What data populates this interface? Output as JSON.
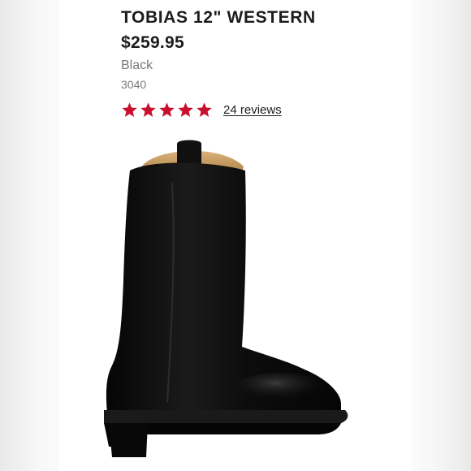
{
  "product": {
    "title": "TOBIAS 12\" WESTERN",
    "price": "$259.95",
    "color": "Black",
    "sku": "3040",
    "image_icon": "western-boot-icon"
  },
  "rating": {
    "stars": 5,
    "max_stars": 5,
    "reviews_label": "24 reviews",
    "star_color": "#c8102e"
  },
  "theme": {
    "text_color": "#1c1c1c",
    "muted_color": "#7a7a7a",
    "boot_color": "#0f0f0f",
    "lining_color": "#c49a5c"
  }
}
